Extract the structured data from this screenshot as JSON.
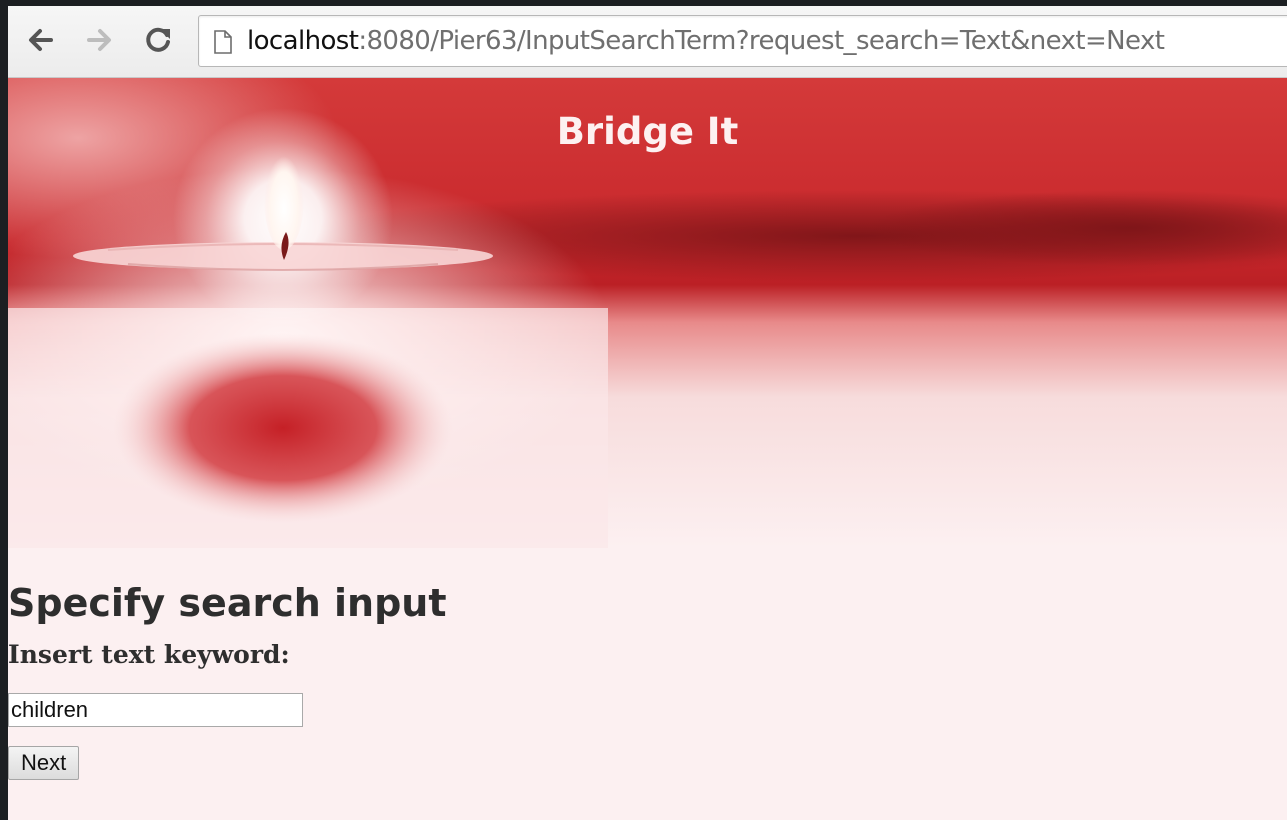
{
  "browser": {
    "url_host": "localhost",
    "url_rest": ":8080/Pier63/InputSearchTerm?request_search=Text&next=Next",
    "back_icon": "arrow-left-icon",
    "forward_icon": "arrow-right-icon",
    "reload_icon": "reload-icon",
    "page_icon": "page-icon"
  },
  "site": {
    "title": "Bridge It"
  },
  "main": {
    "heading": "Specify search input",
    "label": "Insert text keyword:",
    "keyword_value": "children",
    "next_label": "Next"
  },
  "colors": {
    "banner_red": "#c8282c",
    "banner_dark": "#8e1c20",
    "page_bg": "#fcf0f1",
    "heading_text": "#2e2e2e"
  }
}
